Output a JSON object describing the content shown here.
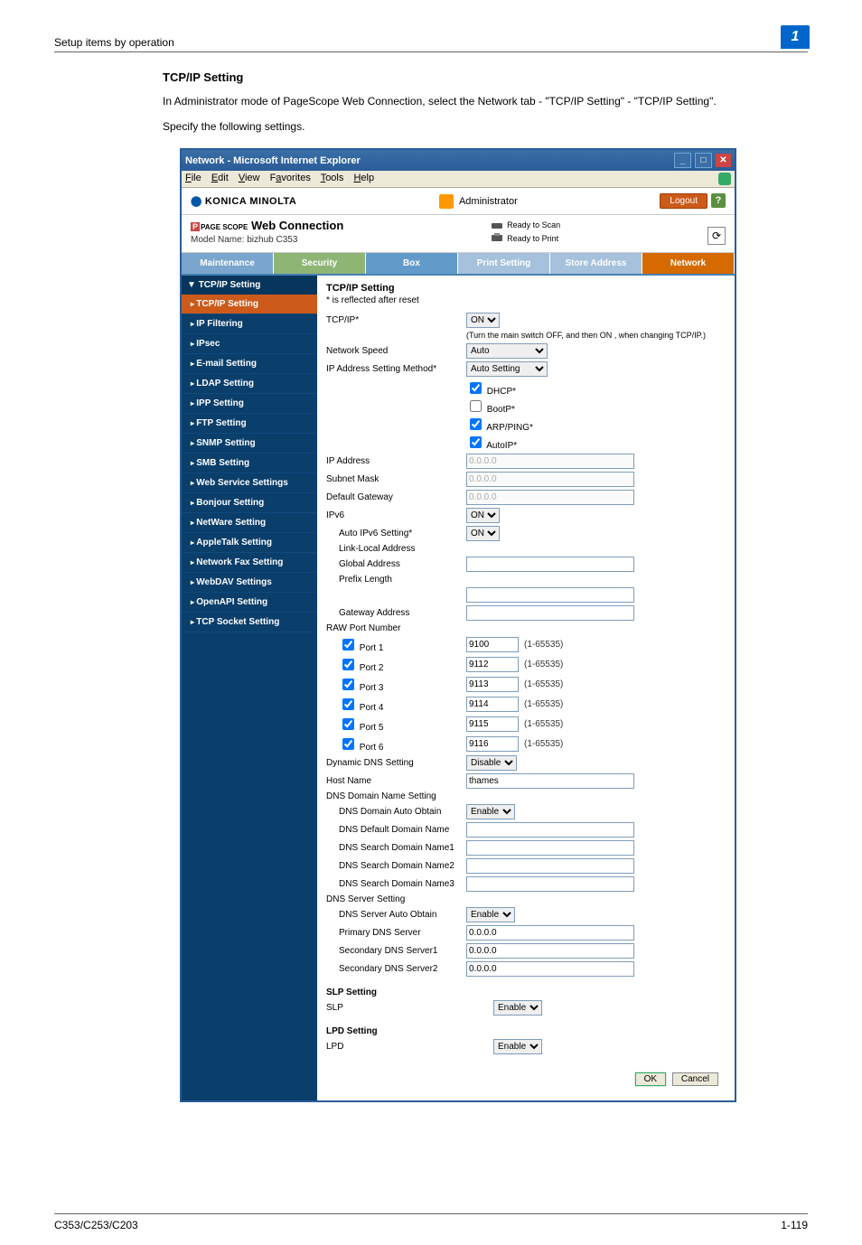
{
  "doc": {
    "header": "Setup items by operation",
    "badge": "1",
    "title": "TCP/IP Setting",
    "intro1": "In Administrator mode of PageScope Web Connection, select the Network tab - \"TCP/IP Setting\" - \"TCP/IP Setting\".",
    "intro2": "Specify the following settings.",
    "footer_left": "C353/C253/C203",
    "footer_right": "1-119"
  },
  "window": {
    "title": "Network - Microsoft Internet Explorer"
  },
  "menu": {
    "file": "File",
    "edit": "Edit",
    "view": "View",
    "favorites": "Favorites",
    "tools": "Tools",
    "help": "Help"
  },
  "header": {
    "brand": "KONICA MINOLTA",
    "admin": "Administrator",
    "logout": "Logout",
    "help": "?",
    "connection": "Web Connection",
    "conn_prefix": "PAGE SCOPE",
    "model": "Model Name: bizhub C353",
    "scan": "Ready to Scan",
    "print": "Ready to Print"
  },
  "tabs": {
    "maintenance": "Maintenance",
    "security": "Security",
    "box": "Box",
    "print_setting": "Print Setting",
    "store_address": "Store Address",
    "network": "Network"
  },
  "sidebar": {
    "head": "TCP/IP Setting",
    "items": [
      "TCP/IP Setting",
      "IP Filtering",
      "IPsec",
      "E-mail Setting",
      "LDAP Setting",
      "IPP Setting",
      "FTP Setting",
      "SNMP Setting",
      "SMB Setting",
      "Web Service Settings",
      "Bonjour Setting",
      "NetWare Setting",
      "AppleTalk Setting",
      "Network Fax Setting",
      "WebDAV Settings",
      "OpenAPI Setting",
      "TCP Socket Setting"
    ]
  },
  "panel": {
    "title": "TCP/IP Setting",
    "note": "* is reflected after reset",
    "tcpip_lbl": "TCP/IP*",
    "tcpip_on": "ON",
    "tcpip_hint": "(Turn the main switch OFF, and then ON , when changing TCP/IP.)",
    "netspeed_lbl": "Network Speed",
    "netspeed_val": "Auto",
    "ipmethod_lbl": "IP Address Setting Method*",
    "ipmethod_val": "Auto Setting",
    "chk_dhcp": "DHCP*",
    "chk_bootp": "BootP*",
    "chk_arp": "ARP/PING*",
    "chk_autoip": "AutoIP*",
    "ipaddr_lbl": "IP Address",
    "ipaddr_val": "0.0.0.0",
    "subnet_lbl": "Subnet Mask",
    "subnet_val": "0.0.0.0",
    "gateway_lbl": "Default Gateway",
    "gateway_val": "0.0.0.0",
    "ipv6_lbl": "IPv6",
    "ipv6_val": "ON",
    "autov6_lbl": "Auto IPv6 Setting*",
    "autov6_val": "ON",
    "linklocal_lbl": "Link-Local Address",
    "global_lbl": "Global Address",
    "prefix_lbl": "Prefix Length",
    "gatewayaddr_lbl": "Gateway Address",
    "raw_head": "RAW Port Number",
    "port1_lbl": "Port 1",
    "port1_val": "9100",
    "port2_lbl": "Port 2",
    "port2_val": "9112",
    "port3_lbl": "Port 3",
    "port3_val": "9113",
    "port4_lbl": "Port 4",
    "port4_val": "9114",
    "port5_lbl": "Port 5",
    "port5_val": "9115",
    "port6_lbl": "Port 6",
    "port6_val": "9116",
    "port_hint": "(1-65535)",
    "dyndns_lbl": "Dynamic DNS Setting",
    "dyndns_val": "Disable",
    "host_lbl": "Host Name",
    "host_val": "thames",
    "dnsdom_head": "DNS Domain Name Setting",
    "dnsdom_auto_lbl": "DNS Domain Auto Obtain",
    "dnsdom_auto_val": "Enable",
    "dnsdef_lbl": "DNS Default Domain Name",
    "dnss1_lbl": "DNS Search Domain Name1",
    "dnss2_lbl": "DNS Search Domain Name2",
    "dnss3_lbl": "DNS Search Domain Name3",
    "dnssrv_head": "DNS Server Setting",
    "dnssrv_auto_lbl": "DNS Server Auto Obtain",
    "dnssrv_auto_val": "Enable",
    "primdns_lbl": "Primary DNS Server",
    "primdns_val": "0.0.0.0",
    "secdns1_lbl": "Secondary DNS Server1",
    "secdns1_val": "0.0.0.0",
    "secdns2_lbl": "Secondary DNS Server2",
    "secdns2_val": "0.0.0.0",
    "slp_head": "SLP Setting",
    "slp_lbl": "SLP",
    "slp_val": "Enable",
    "lpd_head": "LPD Setting",
    "lpd_lbl": "LPD",
    "lpd_val": "Enable",
    "ok": "OK",
    "cancel": "Cancel"
  }
}
